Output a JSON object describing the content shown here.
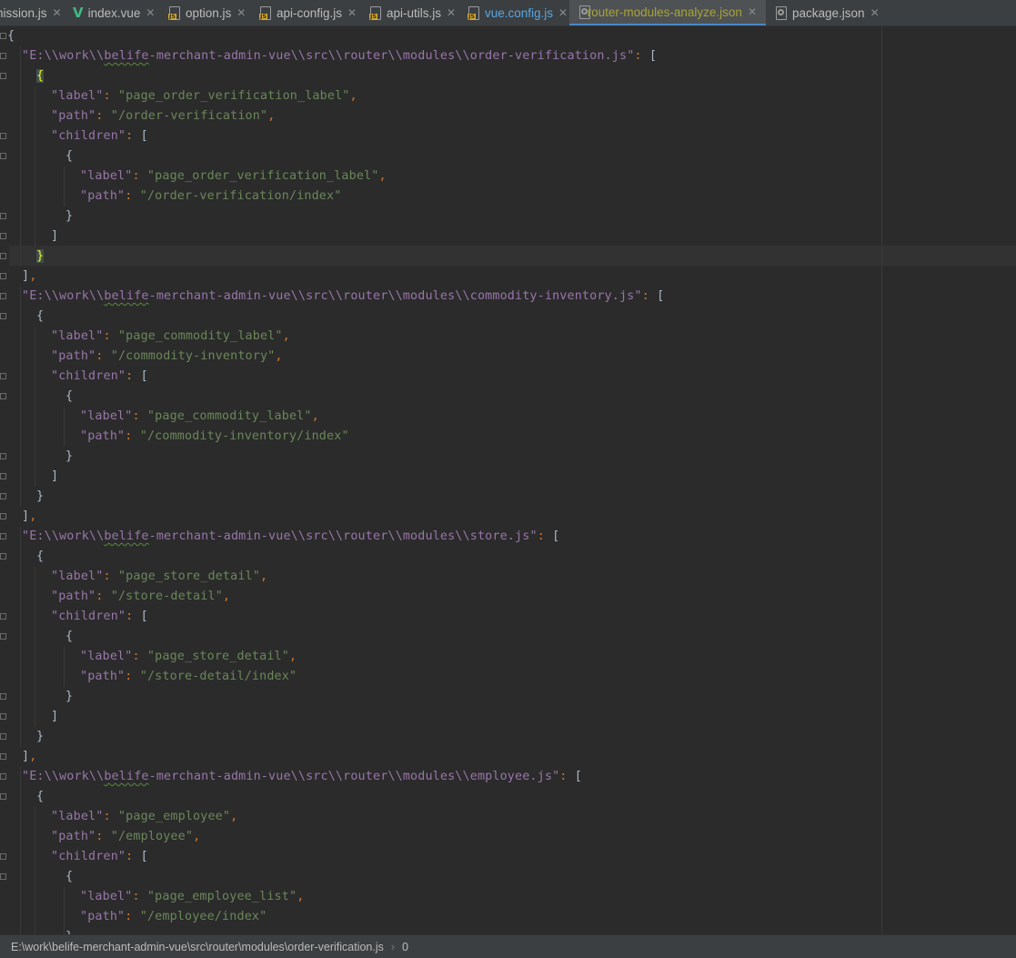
{
  "tabs": [
    {
      "label": "nission.js",
      "icon": "js-file-icon"
    },
    {
      "label": "index.vue",
      "icon": "vue-file-icon"
    },
    {
      "label": "option.js",
      "icon": "js-file-icon"
    },
    {
      "label": "api-config.js",
      "icon": "js-file-icon"
    },
    {
      "label": "api-utils.js",
      "icon": "js-file-icon"
    },
    {
      "label": "vue.config.js",
      "icon": "js-file-icon"
    },
    {
      "label": "router-modules-analyze.json",
      "icon": "json-file-icon",
      "active": true
    },
    {
      "label": "package.json",
      "icon": "json-file-icon"
    }
  ],
  "code": {
    "prefix": "\"E:\\\\work\\\\",
    "proj": "belife",
    "mid": "-merchant-admin-vue\\\\src\\\\router\\\\modules\\\\",
    "modules": [
      {
        "file": "order-verification.js",
        "label": "page_order_verification_label",
        "path": "/order-verification",
        "child_label": "page_order_verification_label",
        "child_path": "/order-verification/index"
      },
      {
        "file": "commodity-inventory.js",
        "label": "page_commodity_label",
        "path": "/commodity-inventory",
        "child_label": "page_commodity_label",
        "child_path": "/commodity-inventory/index"
      },
      {
        "file": "store.js",
        "label": "page_store_detail",
        "path": "/store-detail",
        "child_label": "page_store_detail",
        "child_path": "/store-detail/index"
      },
      {
        "file": "employee.js",
        "label": "page_employee",
        "path": "/employee",
        "child_label": "page_employee_list",
        "child_path": "/employee/index"
      }
    ]
  },
  "status": {
    "path": "E:\\work\\belife-merchant-admin-vue\\src\\router\\modules\\order-verification.js",
    "index": "0"
  },
  "colors": {
    "background": "#2b2b2b",
    "key": "#9876aa",
    "string": "#6a8759",
    "punctuation": "#cc7832",
    "active_tab": "#a8a33b",
    "brace_match": "#ffef28"
  }
}
